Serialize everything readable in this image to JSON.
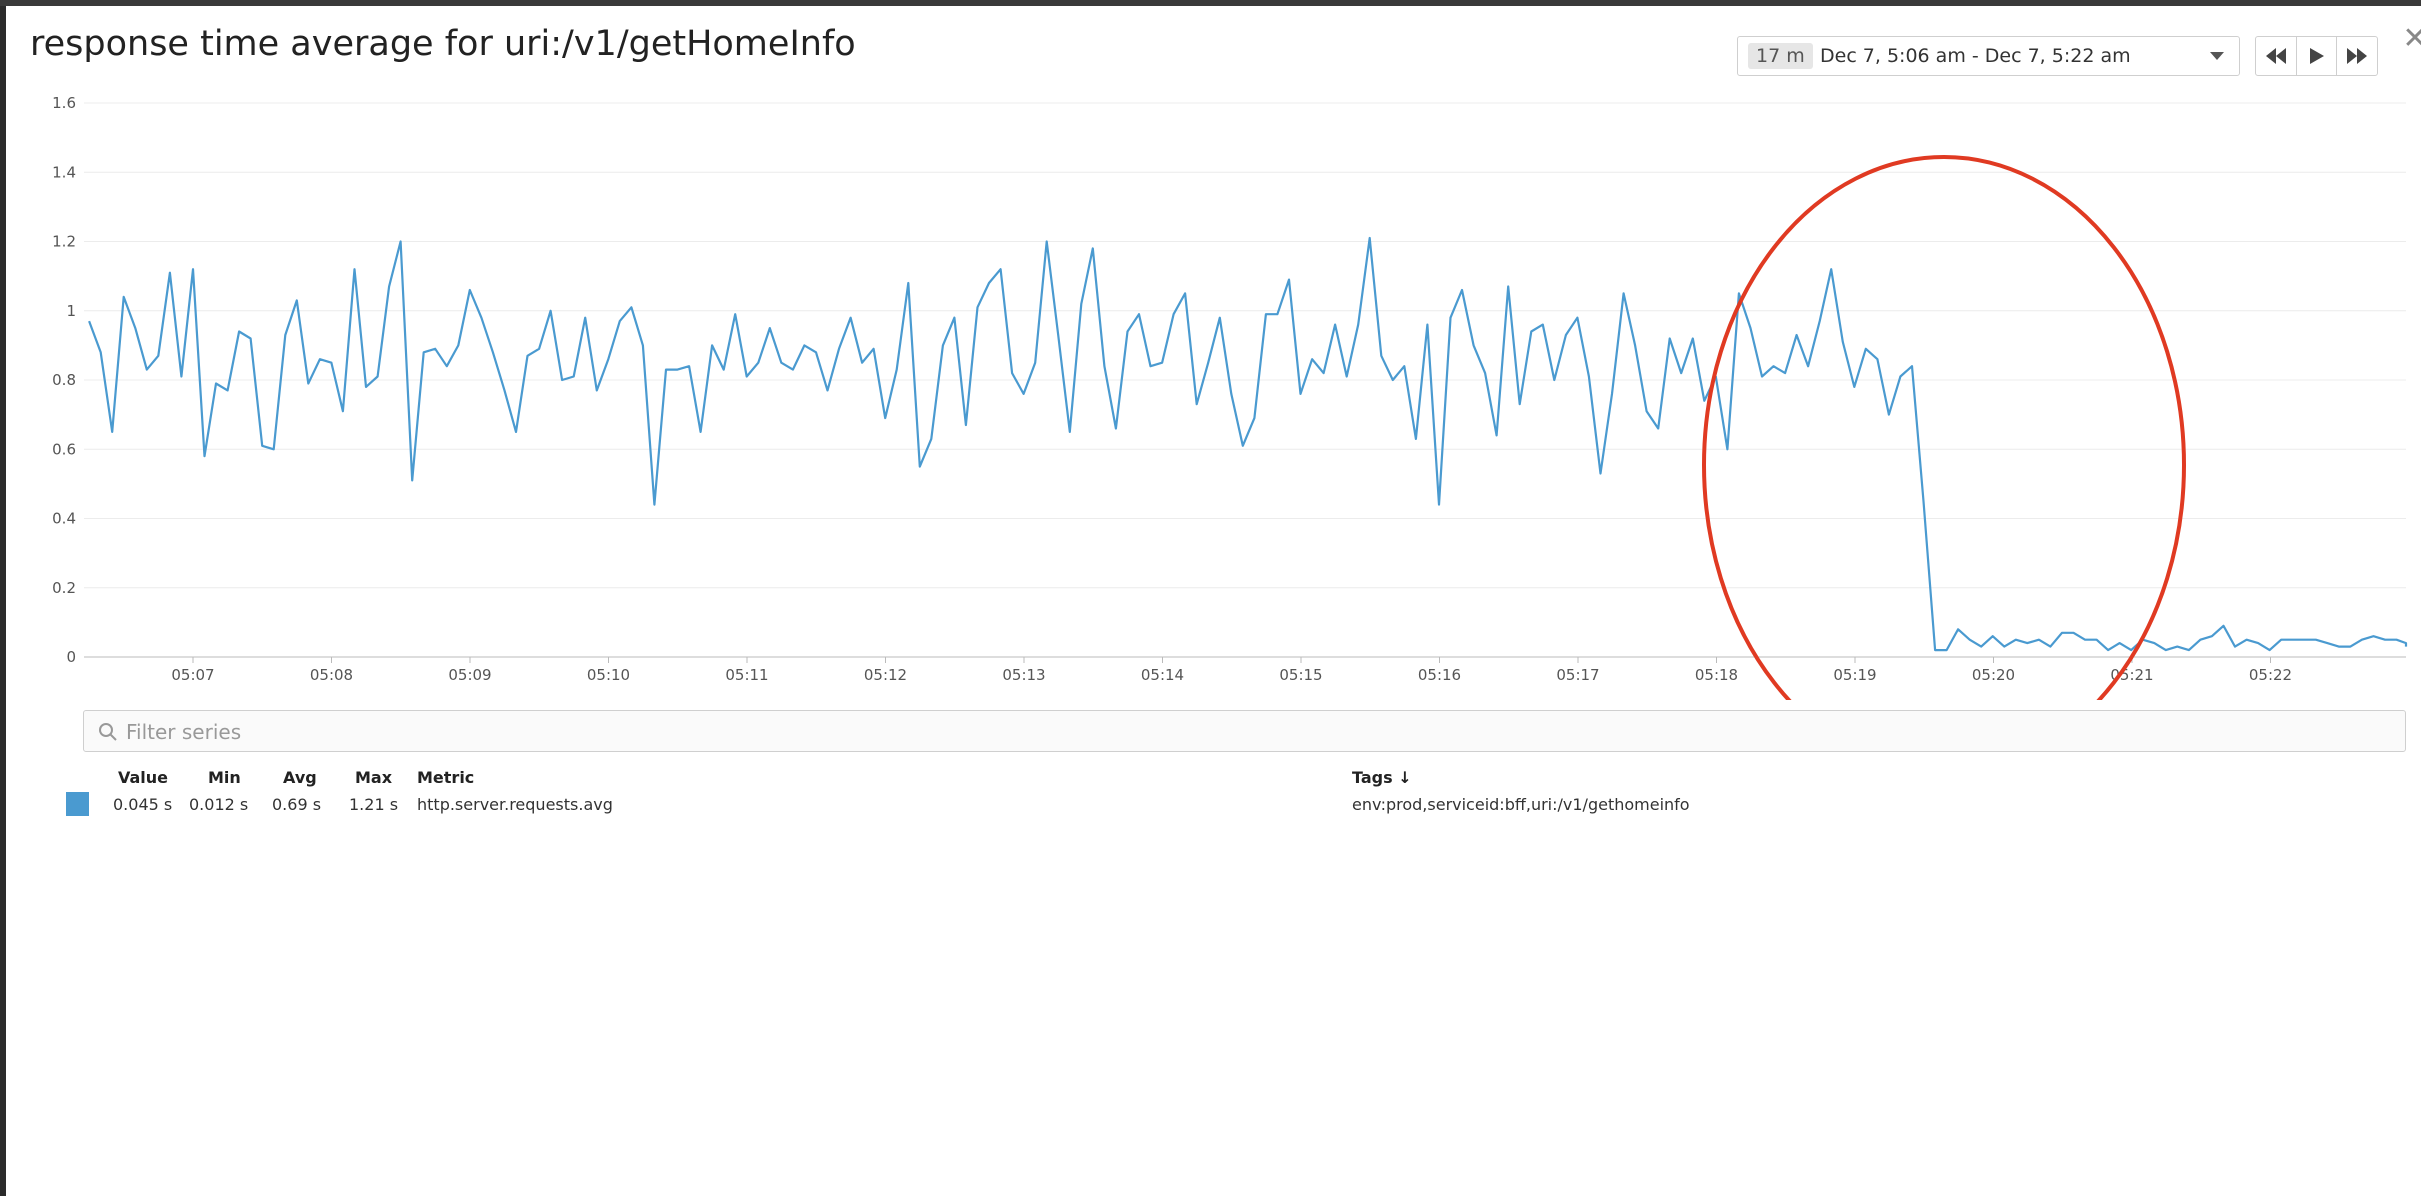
{
  "title": "response time average for uri:/v1/getHomeInfo",
  "time_picker": {
    "badge": "17 m",
    "range": "Dec 7, 5:06 am - Dec 7, 5:22 am"
  },
  "filter": {
    "placeholder": "Filter series"
  },
  "legend": {
    "headers": {
      "value": "Value",
      "min": "Min",
      "avg": "Avg",
      "max": "Max",
      "metric": "Metric",
      "tags": "Tags ↓"
    },
    "row": {
      "value": "0.045 s",
      "min": "0.012 s",
      "avg": "0.69 s",
      "max": "1.21 s",
      "metric": "http.server.requests.avg",
      "tags": "env:prod,serviceid:bff,uri:/v1/gethomeinfo",
      "color": "#4a9ad0"
    }
  },
  "colors": {
    "line": "#4a9ad0",
    "highlight_circle": "#e03a22"
  },
  "chart_data": {
    "type": "line",
    "ylim": [
      0,
      1.6
    ],
    "y_ticks": [
      "0",
      "0.2",
      "0.4",
      "0.6",
      "0.8",
      "1",
      "1.2",
      "1.4",
      "1.6"
    ],
    "x_ticks": [
      "05:07",
      "05:08",
      "05:09",
      "05:10",
      "05:11",
      "05:12",
      "05:13",
      "05:14",
      "05:15",
      "05:16",
      "05:17",
      "05:18",
      "05:19",
      "05:20",
      "05:21",
      "05:22"
    ],
    "x_start_min": 6.25,
    "x_step_min": 0.0833,
    "series": [
      {
        "values": [
          0.97,
          0.88,
          0.65,
          1.04,
          0.95,
          0.83,
          0.87,
          1.11,
          0.81,
          1.12,
          0.58,
          0.79,
          0.77,
          0.94,
          0.92,
          0.61,
          0.6,
          0.93,
          1.03,
          0.79,
          0.86,
          0.85,
          0.71,
          1.12,
          0.78,
          0.81,
          1.07,
          1.2,
          0.51,
          0.88,
          0.89,
          0.84,
          0.9,
          1.06,
          0.98,
          0.88,
          0.77,
          0.65,
          0.87,
          0.89,
          1.0,
          0.8,
          0.81,
          0.98,
          0.77,
          0.86,
          0.97,
          1.01,
          0.9,
          0.44,
          0.83,
          0.83,
          0.84,
          0.65,
          0.9,
          0.83,
          0.99,
          0.81,
          0.85,
          0.95,
          0.85,
          0.83,
          0.9,
          0.88,
          0.77,
          0.89,
          0.98,
          0.85,
          0.89,
          0.69,
          0.83,
          1.08,
          0.55,
          0.63,
          0.9,
          0.98,
          0.67,
          1.01,
          1.08,
          1.12,
          0.82,
          0.76,
          0.85,
          1.2,
          0.93,
          0.65,
          1.02,
          1.18,
          0.84,
          0.66,
          0.94,
          0.99,
          0.84,
          0.85,
          0.99,
          1.05,
          0.73,
          0.85,
          0.98,
          0.76,
          0.61,
          0.69,
          0.99,
          0.99,
          1.09,
          0.76,
          0.86,
          0.82,
          0.96,
          0.81,
          0.96,
          1.21,
          0.87,
          0.8,
          0.84,
          0.63,
          0.96,
          0.44,
          0.98,
          1.06,
          0.9,
          0.82,
          0.64,
          1.07,
          0.73,
          0.94,
          0.96,
          0.8,
          0.93,
          0.98,
          0.81,
          0.53,
          0.76,
          1.05,
          0.9,
          0.71,
          0.66,
          0.92,
          0.82,
          0.92,
          0.74,
          0.81,
          0.6,
          1.05,
          0.95,
          0.81,
          0.84,
          0.82,
          0.93,
          0.84,
          0.97,
          1.12,
          0.91,
          0.78,
          0.89,
          0.86,
          0.7,
          0.81,
          0.84,
          0.45,
          0.02,
          0.02,
          0.08,
          0.05,
          0.03,
          0.06,
          0.03,
          0.05,
          0.04,
          0.05,
          0.03,
          0.07,
          0.07,
          0.05,
          0.05,
          0.02,
          0.04,
          0.02,
          0.05,
          0.04,
          0.02,
          0.03,
          0.02,
          0.05,
          0.06,
          0.09,
          0.03,
          0.05,
          0.04,
          0.02,
          0.05,
          0.05,
          0.05,
          0.05,
          0.04,
          0.03,
          0.03,
          0.05,
          0.06,
          0.05,
          0.05,
          0.04,
          0.04,
          0.03
        ]
      }
    ]
  }
}
